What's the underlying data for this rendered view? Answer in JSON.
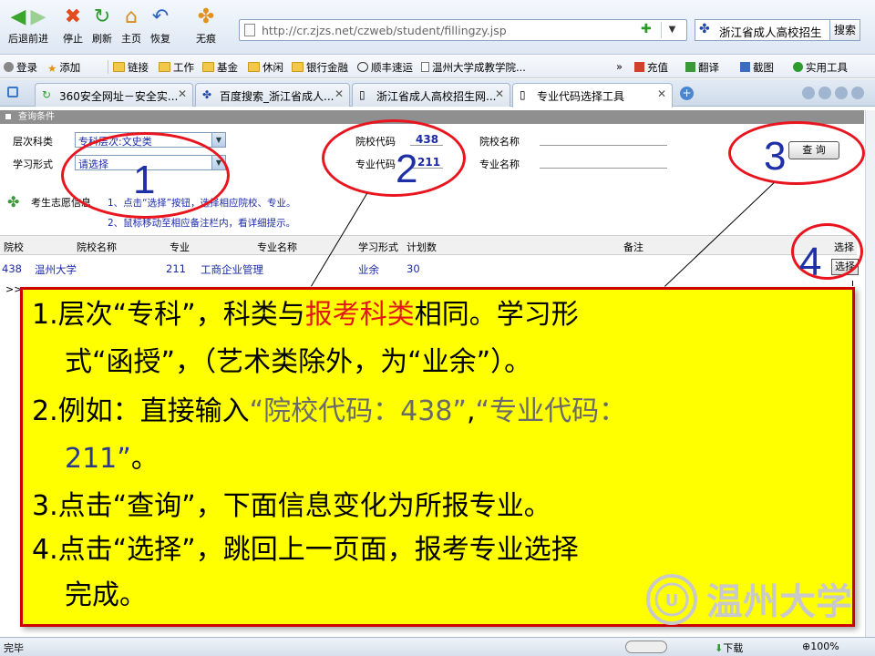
{
  "nav": {
    "back": "后退",
    "forward": "前进",
    "stop": "停止",
    "refresh": "刷新",
    "home": "主页",
    "restore": "恢复",
    "incognito": "无痕",
    "url": "http://cr.zjzs.net/czweb/student/fillingzy.jsp",
    "search_text": "浙江省成人高校招生",
    "search_button": "搜索"
  },
  "bookmarks": {
    "login": "登录",
    "add": "添加",
    "links": "链接",
    "work": "工作",
    "fund": "基金",
    "leisure": "休闲",
    "bank": "银行金融",
    "sf": "顺丰速运",
    "wzu": "温州大学成教学院...",
    "recharge": "充值",
    "translate": "翻译",
    "screenshot": "截图",
    "tools": "实用工具"
  },
  "tabs": [
    "360安全网址－安全实...",
    "百度搜索_浙江省成人...",
    "浙江省成人高校招生网...",
    "专业代码选择工具"
  ],
  "form": {
    "section_title": "查询条件",
    "level_label": "层次科类",
    "level_value": "专科层次:文史类",
    "mode_label": "学习形式",
    "mode_value": "请选择",
    "school_code_label": "院校代码",
    "school_code_value": "438",
    "major_code_label": "专业代码",
    "major_code_value": "211",
    "school_name_label": "院校名称",
    "major_name_label": "专业名称",
    "query_button": "查 询",
    "info_label": "考生志愿信息",
    "hint1": "1、点击“选择”按钮，选择相应院校、专业。",
    "hint2": "2、鼠标移动至相应备注栏内，看详细提示。"
  },
  "table": {
    "headers": [
      "院校",
      "院校名称",
      "专业",
      "专业名称",
      "学习形式",
      "计划数",
      "备注",
      "选择"
    ],
    "row": {
      "school_code": "438",
      "school_name": "温州大学",
      "major_code": "211",
      "major_name": "工商企业管理",
      "mode": "业余",
      "plan": "30",
      "note": "",
      "choose": "选择"
    },
    "more": ">>"
  },
  "annotations": {
    "n1": "1",
    "n2": "2",
    "n3": "3",
    "n4": "4"
  },
  "instructions": {
    "l1a": "1.层次“专科”，科类与",
    "l1b": "报考科类",
    "l1c": "相同。学习形",
    "l2": "式“函授”，（艺术类除外，为“业余”）。",
    "l3a": "2.例如：直接输入",
    "l3b": "“院校代码：438”",
    "l3c": ",",
    "l3d": "“专业代码：",
    "l4a": "211”",
    "l4b": "。",
    "l5": "3.点击“查询”，下面信息变化为所报专业。",
    "l6": "4.点击“选择”，跳回上一页面，报考专业选择",
    "l7": "完成。"
  },
  "logo_text": "温州大学",
  "status": {
    "text": "完毕",
    "download": "下载",
    "zoom": "100%"
  }
}
